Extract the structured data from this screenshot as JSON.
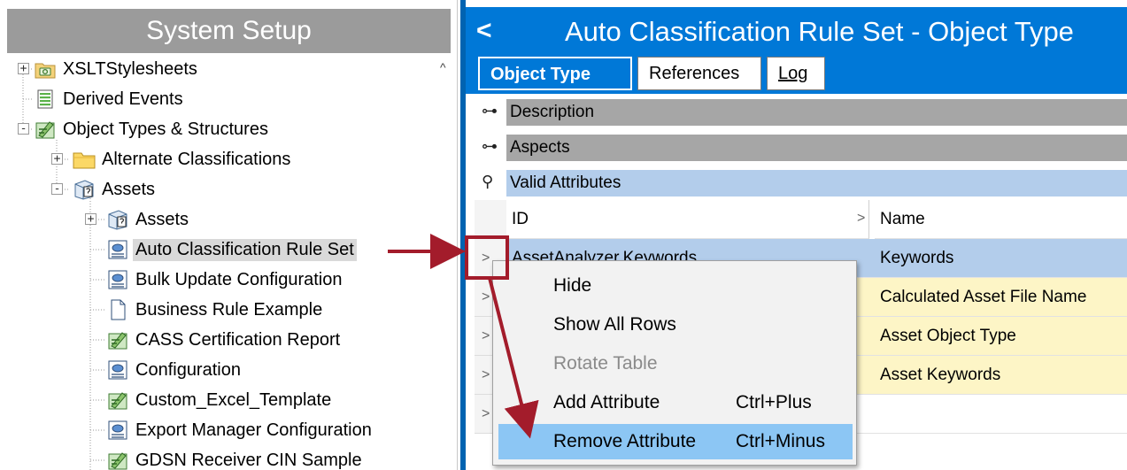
{
  "left_panel": {
    "title": "System Setup",
    "tree": [
      {
        "label": "XSLTStylesheets",
        "icon": "camera-folder-icon",
        "level": 0,
        "toggle": "+"
      },
      {
        "label": "Derived Events",
        "icon": "list-document-icon",
        "level": 0,
        "toggle": ""
      },
      {
        "label": "Object Types & Structures",
        "icon": "object-types-icon",
        "level": 0,
        "toggle": "-"
      },
      {
        "label": "Alternate Classifications",
        "icon": "folder-icon",
        "level": 1,
        "toggle": "+"
      },
      {
        "label": "Assets",
        "icon": "asset-type-icon",
        "level": 1,
        "toggle": "-"
      },
      {
        "label": "Assets",
        "icon": "asset-type-icon",
        "level": 2,
        "toggle": "+"
      },
      {
        "label": "Auto Classification Rule Set",
        "icon": "config-object-icon",
        "level": 2,
        "toggle": "",
        "selected": true
      },
      {
        "label": "Bulk Update Configuration",
        "icon": "config-object-icon",
        "level": 2,
        "toggle": ""
      },
      {
        "label": "Business Rule Example",
        "icon": "blank-document-icon",
        "level": 2,
        "toggle": ""
      },
      {
        "label": "CASS Certification Report",
        "icon": "object-types-icon",
        "level": 2,
        "toggle": ""
      },
      {
        "label": "Configuration",
        "icon": "config-object-icon",
        "level": 2,
        "toggle": ""
      },
      {
        "label": "Custom_Excel_Template",
        "icon": "object-types-icon",
        "level": 2,
        "toggle": ""
      },
      {
        "label": "Export Manager Configuration",
        "icon": "config-object-icon",
        "level": 2,
        "toggle": ""
      },
      {
        "label": "GDSN Receiver CIN Sample",
        "icon": "object-types-icon",
        "level": 2,
        "toggle": ""
      }
    ],
    "scroll_up_glyph": "^"
  },
  "right_panel": {
    "back_glyph": "<",
    "title": "Auto Classification Rule Set - Object Type",
    "tabs": [
      {
        "label": "Object Type",
        "active": true
      },
      {
        "label": "References",
        "active": false
      },
      {
        "label": "Log",
        "active": false
      }
    ],
    "sections": [
      {
        "label": "Description",
        "icon": "expand-section-icon",
        "state": "collapsed"
      },
      {
        "label": "Aspects",
        "icon": "expand-section-icon",
        "state": "collapsed"
      },
      {
        "label": "Valid Attributes",
        "icon": "pin-section-icon",
        "state": "expanded"
      }
    ],
    "grid": {
      "columns": [
        "ID",
        "Name"
      ],
      "sort_glyph": ">",
      "rows": [
        {
          "marker": ">",
          "id": "AssetAnalyzer.Keywords",
          "name": "Keywords"
        },
        {
          "marker": ">",
          "id": "",
          "name": "Calculated Asset File Name"
        },
        {
          "marker": ">",
          "id": "",
          "name": "Asset Object Type"
        },
        {
          "marker": ">",
          "id": "",
          "name": "Asset Keywords"
        },
        {
          "marker": ">",
          "id": "",
          "name": ""
        }
      ]
    }
  },
  "context_menu": {
    "items": [
      {
        "label": "Hide",
        "shortcut": "",
        "enabled": true,
        "highlighted": false
      },
      {
        "label": "Show All Rows",
        "shortcut": "",
        "enabled": true,
        "highlighted": false
      },
      {
        "label": "Rotate Table",
        "shortcut": "",
        "enabled": false,
        "highlighted": false
      },
      {
        "label": "Add Attribute",
        "shortcut": "Ctrl+Plus",
        "enabled": true,
        "highlighted": false
      },
      {
        "label": "Remove Attribute",
        "shortcut": "Ctrl+Minus",
        "enabled": true,
        "highlighted": true
      }
    ]
  },
  "colors": {
    "header_blue": "#0078d7",
    "left_header_gray": "#9b9b9b",
    "section_gray": "#a6a6a6",
    "section_blue": "#b3cdeb",
    "selected_row_blue": "#b3cdeb",
    "row_yellow": "#fdf5c6",
    "menu_highlight": "#8cc6f4",
    "annotation_red": "#a31c2b"
  }
}
